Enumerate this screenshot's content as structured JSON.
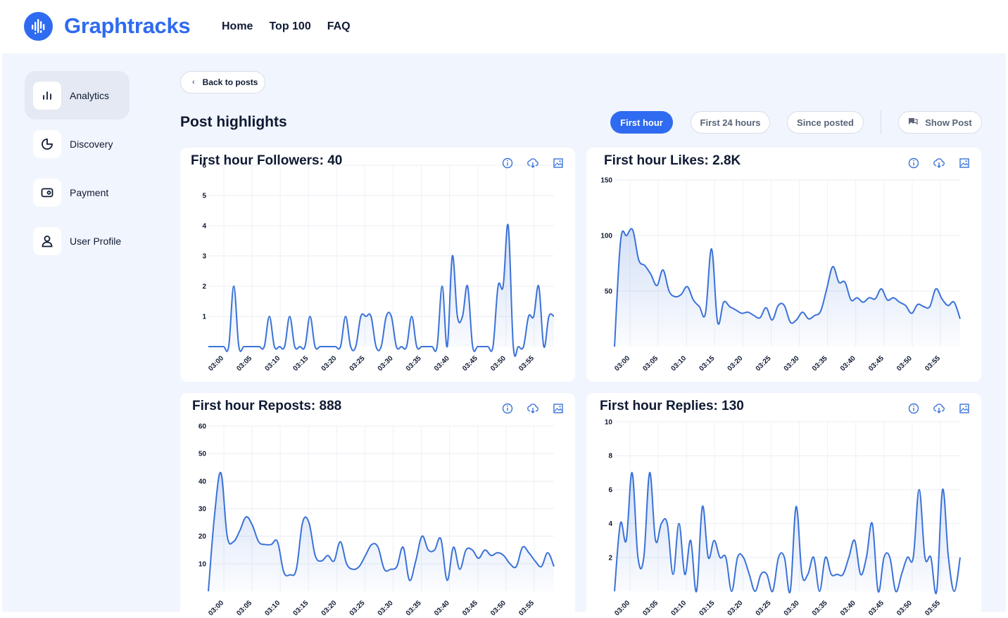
{
  "app": {
    "name": "Graphtracks",
    "brand_color": "#2f6bf0"
  },
  "nav": [
    "Home",
    "Top 100",
    "FAQ"
  ],
  "sidebar": {
    "items": [
      {
        "label": "Analytics",
        "icon": "bar-chart-icon",
        "active": true
      },
      {
        "label": "Discovery",
        "icon": "pie-chart-icon",
        "active": false
      },
      {
        "label": "Payment",
        "icon": "wallet-icon",
        "active": false
      },
      {
        "label": "User Profile",
        "icon": "user-icon",
        "active": false
      }
    ]
  },
  "back_label": "Back to posts",
  "page_title": "Post highlights",
  "range_tabs": [
    {
      "label": "First hour",
      "active": true
    },
    {
      "label": "First 24 hours",
      "active": false
    },
    {
      "label": "Since posted",
      "active": false
    }
  ],
  "show_post_label": "Show Post",
  "chart_data": [
    {
      "type": "area",
      "title": "First hour Followers: 40",
      "x_ticks": [
        "03:00",
        "03:05",
        "03:10",
        "03:15",
        "03:20",
        "03:25",
        "03:30",
        "03:35",
        "03:40",
        "03:45",
        "03:50",
        "03:55"
      ],
      "y_ticks": [
        1,
        2,
        3,
        4,
        5,
        6
      ],
      "ylim": [
        0,
        6
      ],
      "grid": true,
      "values": [
        0,
        0,
        0,
        0,
        0,
        2,
        0,
        0,
        0,
        0,
        0,
        0,
        1,
        0,
        0,
        0,
        1,
        0,
        0,
        0,
        1,
        0,
        0,
        0,
        0,
        0,
        0,
        1,
        0,
        0,
        1,
        1,
        1,
        0,
        0,
        1,
        1,
        0,
        0,
        0,
        1,
        0,
        0,
        0,
        0,
        0,
        2,
        0,
        3,
        1,
        1,
        2,
        0,
        0,
        0,
        0,
        0,
        2,
        2,
        4,
        0,
        0,
        0,
        1,
        1,
        2,
        0,
        1,
        1
      ]
    },
    {
      "type": "area",
      "title": "First hour Likes: 2.8K",
      "x_ticks": [
        "03:00",
        "03:05",
        "03:10",
        "03:15",
        "03:20",
        "03:25",
        "03:30",
        "03:35",
        "03:40",
        "03:45",
        "03:50",
        "03:55"
      ],
      "y_ticks": [
        50,
        100,
        150
      ],
      "ylim": [
        0,
        150
      ],
      "grid": true,
      "values": [
        0,
        95,
        100,
        105,
        78,
        73,
        65,
        55,
        69,
        50,
        45,
        47,
        54,
        42,
        36,
        30,
        88,
        22,
        40,
        36,
        33,
        30,
        31,
        28,
        26,
        35,
        24,
        37,
        37,
        22,
        24,
        31,
        25,
        28,
        32,
        52,
        72,
        58,
        58,
        42,
        44,
        40,
        44,
        43,
        52,
        42,
        44,
        40,
        37,
        30,
        38,
        36,
        36,
        52,
        43,
        37,
        40,
        25
      ]
    },
    {
      "type": "area",
      "title": "First hour Reposts: 888",
      "x_ticks": [
        "03:00",
        "03:05",
        "03:10",
        "03:15",
        "03:20",
        "03:25",
        "03:30",
        "03:35",
        "03:40",
        "03:45",
        "03:50",
        "03:55"
      ],
      "y_ticks": [
        10,
        20,
        30,
        40,
        50,
        60
      ],
      "ylim": [
        0,
        60
      ],
      "grid": true,
      "values": [
        0,
        28,
        43,
        20,
        18,
        22,
        27,
        24,
        18,
        17,
        17,
        18,
        7,
        6,
        8,
        25,
        25,
        13,
        11,
        13,
        11,
        18,
        10,
        8,
        9,
        13,
        17,
        16,
        8,
        8,
        9,
        16,
        4,
        11,
        20,
        15,
        15,
        19,
        4,
        16,
        8,
        15,
        15,
        12,
        15,
        13,
        14,
        13,
        10,
        9,
        16,
        14,
        11,
        9,
        14,
        9
      ]
    },
    {
      "type": "area",
      "title": "First hour Replies: 130",
      "x_ticks": [
        "03:00",
        "03:05",
        "03:10",
        "03:15",
        "03:20",
        "03:25",
        "03:30",
        "03:35",
        "03:40",
        "03:45",
        "03:50",
        "03:55"
      ],
      "y_ticks": [
        2,
        4,
        6,
        8,
        10
      ],
      "ylim": [
        0,
        10
      ],
      "grid": true,
      "values": [
        0,
        4,
        3,
        7,
        2,
        2,
        7,
        3,
        4,
        4,
        1,
        4,
        1,
        3,
        0,
        5,
        2,
        3,
        2,
        2,
        0,
        2,
        2,
        1,
        0,
        1,
        1,
        0,
        2,
        2,
        0,
        5,
        1,
        1,
        2,
        0,
        2,
        1,
        1,
        1,
        2,
        3,
        1,
        2,
        4,
        0,
        2,
        2,
        0,
        1,
        2,
        2,
        6,
        2,
        2,
        0,
        6,
        2,
        0,
        2
      ]
    }
  ],
  "colors": {
    "line": "#3a72d8",
    "page_bg": "#f1f5fd",
    "grid": "#eef1f6"
  }
}
